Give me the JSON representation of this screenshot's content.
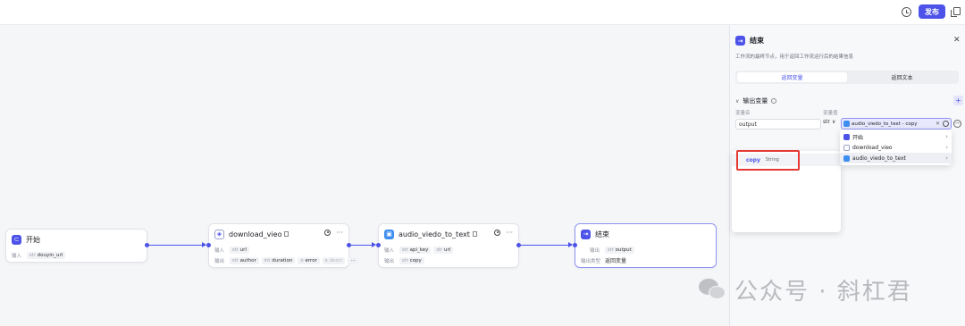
{
  "toolbar": {
    "publish_label": "发布"
  },
  "nodes": {
    "start": {
      "title": "开始",
      "input_label": "输入",
      "var": "douyin_url"
    },
    "download": {
      "title": "download_vieo",
      "input_label": "输入",
      "output_label": "输出",
      "inputs": [
        "url"
      ],
      "outputs": [
        "author",
        "duration",
        "error",
        "descr"
      ]
    },
    "audio": {
      "title": "audio_viedo_to_text",
      "input_label": "输入",
      "output_label": "输出",
      "inputs": [
        "api_key",
        "url"
      ],
      "outputs": [
        "copy"
      ]
    },
    "end": {
      "title": "结束",
      "output_label": "输出",
      "var": "output",
      "type_label": "输出类型",
      "type_value": "返回变量"
    }
  },
  "panel": {
    "title": "结束",
    "description": "工作流的最终节点，用于返回工作流运行后的结果信息",
    "tabs": [
      {
        "label": "返回变量",
        "active": true
      },
      {
        "label": "返回文本",
        "active": false
      }
    ],
    "section_title": "输出变量",
    "col_name": "变量名",
    "col_value": "变量值",
    "row": {
      "name": "output",
      "type": "str",
      "value": "audio_viedo_to_text - copy"
    }
  },
  "dropdown": {
    "items": [
      {
        "label": "开始",
        "icon": "start-icon"
      },
      {
        "label": "download_vieo",
        "icon": "plugin-icon"
      },
      {
        "label": "audio_viedo_to_text",
        "icon": "plugin-icon"
      }
    ],
    "sub": {
      "label": "copy",
      "type": "String"
    }
  },
  "watermark": {
    "text": "公众号 · 斜杠君"
  },
  "colors": {
    "accent": "#4d53e8",
    "highlight": "#e53935"
  }
}
